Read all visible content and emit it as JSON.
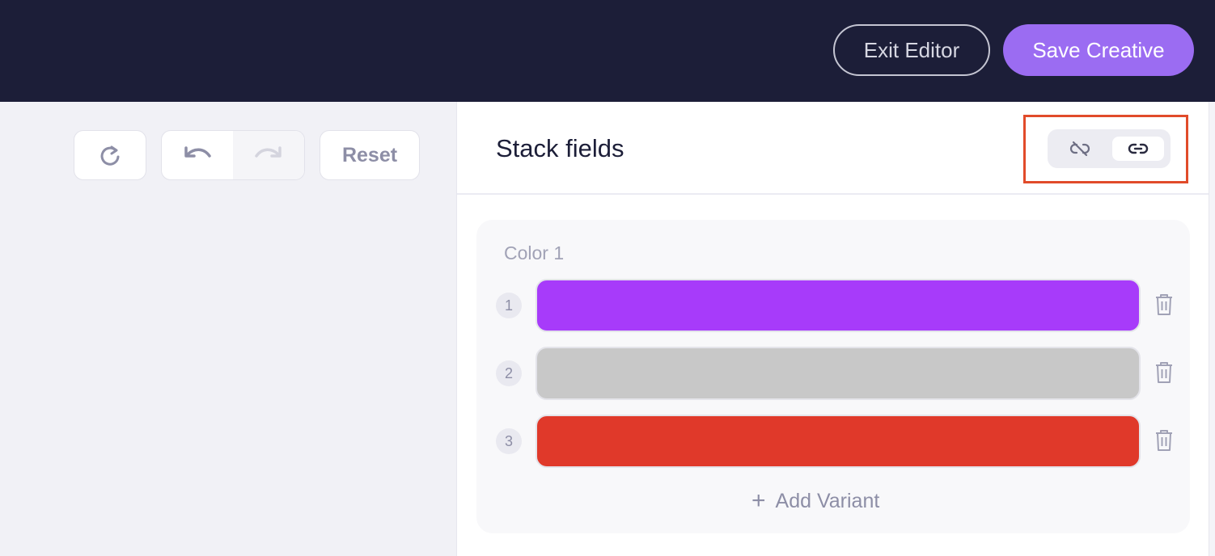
{
  "topbar": {
    "exit_label": "Exit Editor",
    "save_label": "Save Creative"
  },
  "toolbar": {
    "reset_label": "Reset"
  },
  "panel": {
    "title": "Stack fields",
    "card": {
      "label": "Color 1",
      "variants": [
        {
          "number": "1",
          "color": "#a73bfa"
        },
        {
          "number": "2",
          "color": "#c8c8c8"
        },
        {
          "number": "3",
          "color": "#e0392a"
        }
      ],
      "add_label": "Add Variant"
    }
  },
  "colors": {
    "topbar_bg": "#1c1e38",
    "accent": "#9b6cf2",
    "highlight": "#e14b2a"
  },
  "icons": [
    "refresh-icon",
    "undo-icon",
    "redo-icon",
    "unlink-icon",
    "link-icon",
    "trash-icon",
    "plus-icon"
  ]
}
